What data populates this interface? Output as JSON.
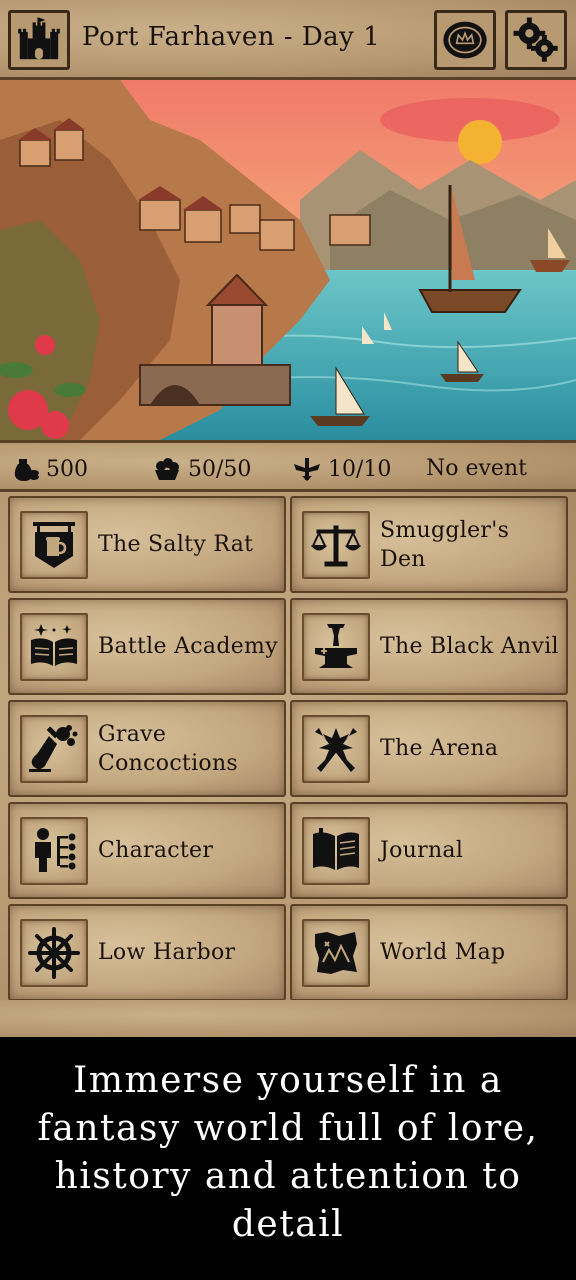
{
  "header": {
    "title": "Port Farhaven - Day 1",
    "icons": {
      "left": "castle-icon",
      "right_1": "coin-icon",
      "right_2": "gear-icon"
    }
  },
  "status": {
    "gold": "500",
    "food": "50/50",
    "guards": "10/10",
    "event": "No event"
  },
  "locations": [
    {
      "label": "The Salty Rat",
      "icon": "tavern-sign-icon"
    },
    {
      "label": "Smuggler's Den",
      "icon": "scales-icon"
    },
    {
      "label": "Battle Academy",
      "icon": "open-book-icon"
    },
    {
      "label": "The Black Anvil",
      "icon": "anvil-icon"
    },
    {
      "label": "Grave Concoctions",
      "icon": "potion-flask-icon"
    },
    {
      "label": "The Arena",
      "icon": "crossed-swords-icon"
    },
    {
      "label": "Character",
      "icon": "character-tree-icon"
    },
    {
      "label": "Journal",
      "icon": "journal-icon"
    },
    {
      "label": "Low Harbor",
      "icon": "ship-wheel-icon"
    },
    {
      "label": "World Map",
      "icon": "map-icon"
    }
  ],
  "promo": {
    "text": "Immerse yourself in a fantasy world full of lore, history and attention to detail"
  },
  "colors": {
    "parchment": "#c2a67e",
    "border": "#5a4026",
    "ink": "#1a120a",
    "sea": "#3fa6b0",
    "sun": "#f4b232"
  }
}
